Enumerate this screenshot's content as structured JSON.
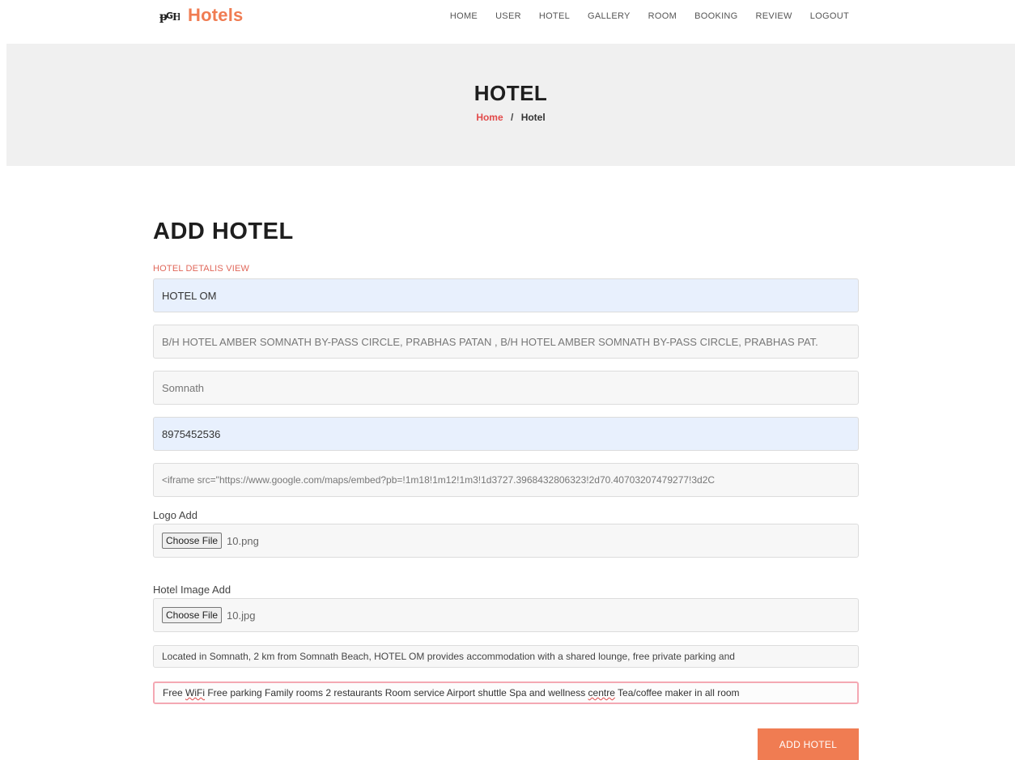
{
  "brand": {
    "name": "Hotels",
    "logo_icon": "monogram-logo-icon",
    "accent_color": "#f07c52"
  },
  "nav": {
    "items": [
      "HOME",
      "USER",
      "HOTEL",
      "GALLERY",
      "ROOM",
      "BOOKING",
      "REVIEW",
      "LOGOUT"
    ]
  },
  "hero": {
    "title": "HOTEL",
    "breadcrumb": {
      "home": "Home",
      "separator": "/",
      "current": "Hotel"
    }
  },
  "form": {
    "title": "ADD HOTEL",
    "subtitle": "HOTEL DETALIS VIEW",
    "hotel_name": "HOTEL OM",
    "address": "B/H HOTEL AMBER SOMNATH BY-PASS CIRCLE, PRABHAS PATAN , B/H HOTEL AMBER SOMNATH BY-PASS CIRCLE, PRABHAS PAT.",
    "city": "Somnath",
    "phone": "8975452536",
    "map_embed": "<iframe src=\"https://www.google.com/maps/embed?pb=!1m18!1m12!1m3!1d3727.3968432806323!2d70.40703207479277!3d2C",
    "logo": {
      "label": "Logo Add",
      "button": "Choose File",
      "file_name": "10.png"
    },
    "hotel_image": {
      "label": "Hotel Image Add",
      "button": "Choose File",
      "file_name": "10.jpg"
    },
    "description": "Located in Somnath, 2 km from Somnath Beach, HOTEL OM provides accommodation with a shared lounge, free private parking and",
    "facilities": {
      "part1": "Free ",
      "wifi": "WiFi",
      "part2": " Free parking Family rooms 2 restaurants Room service Airport shuttle Spa and wellness ",
      "centre": "centre",
      "part3": " Tea/coffee maker in all room"
    },
    "submit_label": "ADD HOTEL"
  }
}
